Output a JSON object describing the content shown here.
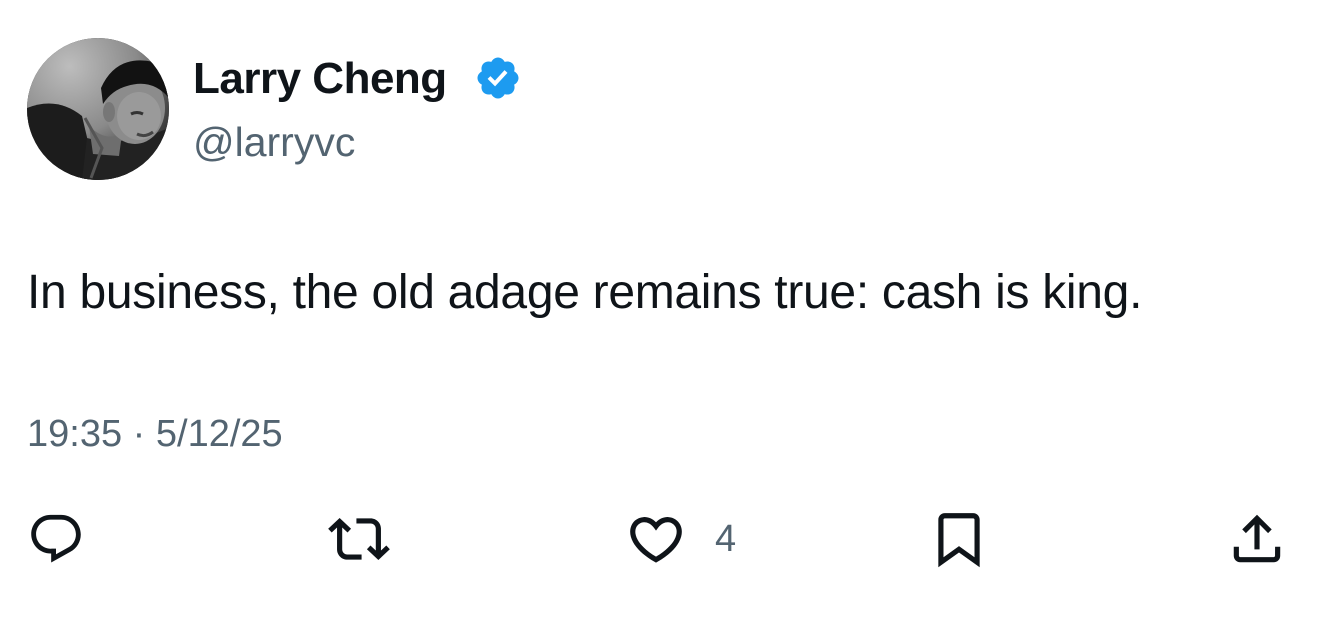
{
  "author": {
    "name": "Larry Cheng",
    "handle": "@larryvc",
    "verified": true,
    "verified_color": "#1d9bf0"
  },
  "tweet": {
    "text": "In business, the old adage remains true: cash is king.",
    "time": "19:35",
    "separator": "·",
    "date": "5/12/25"
  },
  "actions": {
    "reply": {
      "icon": "reply-icon"
    },
    "repost": {
      "icon": "repost-icon"
    },
    "like": {
      "icon": "heart-icon",
      "count": "4"
    },
    "bookmark": {
      "icon": "bookmark-icon"
    },
    "share": {
      "icon": "share-icon"
    }
  },
  "colors": {
    "text": "#0f1419",
    "secondary": "#536471",
    "background": "#ffffff"
  }
}
